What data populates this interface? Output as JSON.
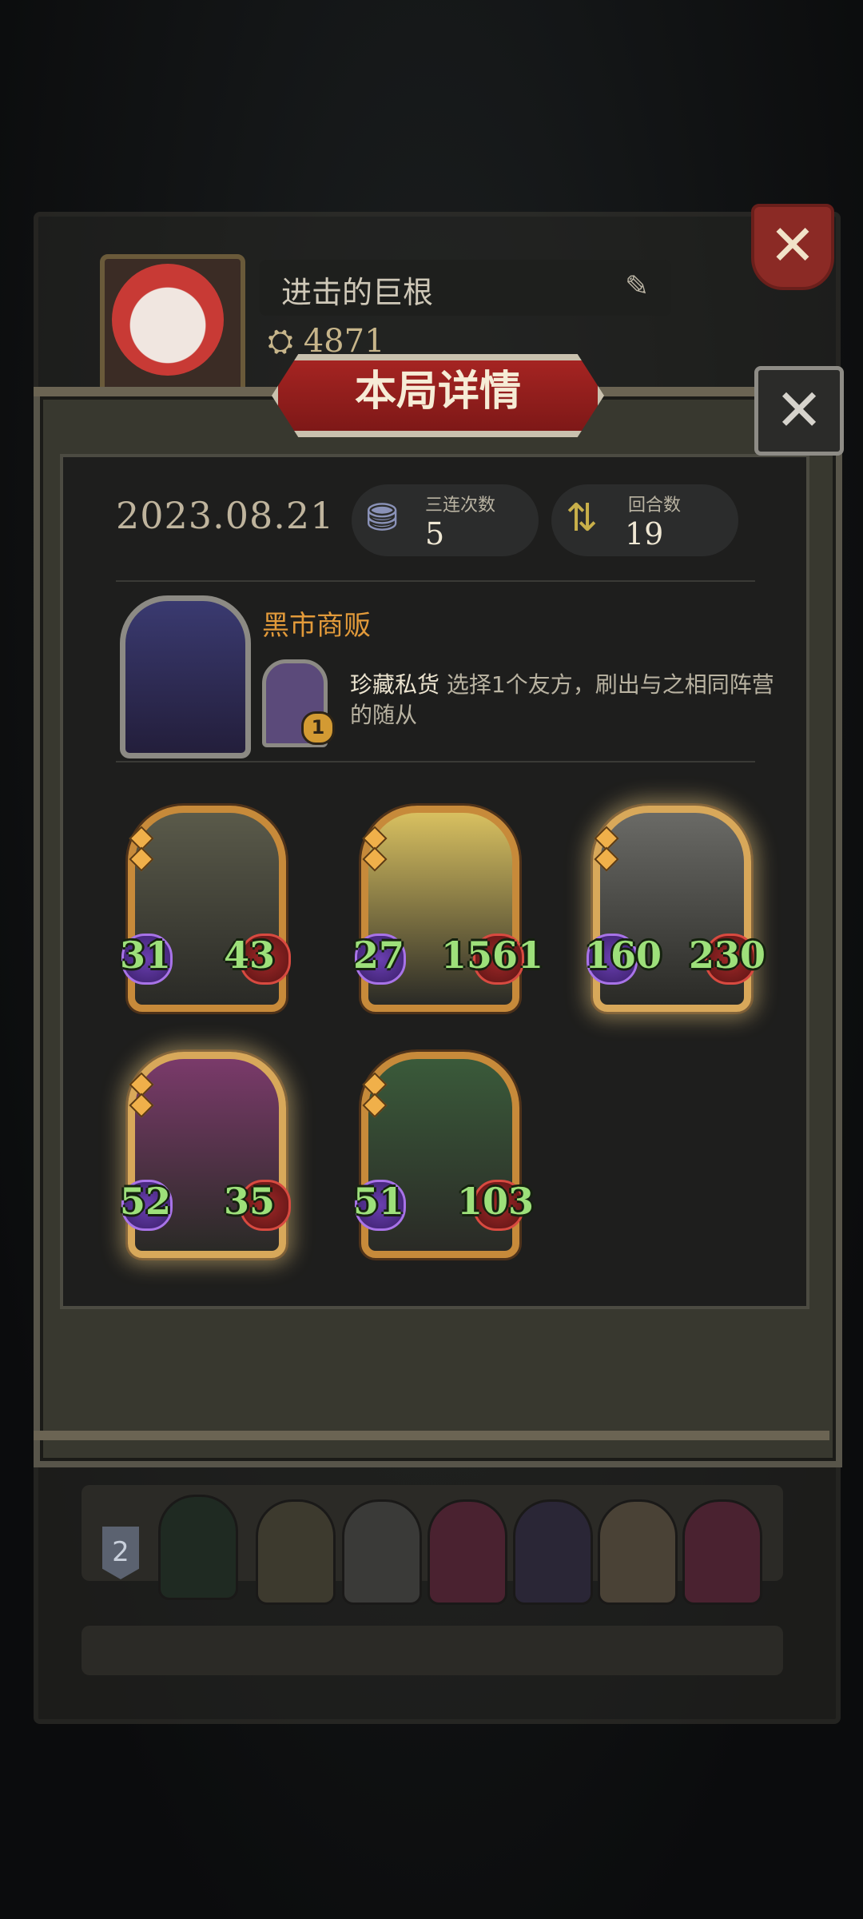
{
  "back_panel": {
    "player_name": "进击的巨根",
    "coins": "4871"
  },
  "modal": {
    "title": "本局详情",
    "date": "2023.08.21",
    "stats": [
      {
        "label": "三连次数",
        "value": "5",
        "icon": "triple-stack-icon"
      },
      {
        "label": "回合数",
        "value": "19",
        "icon": "turn-cycle-icon"
      }
    ],
    "hero": {
      "name": "黑市商贩",
      "ability_name": "珍藏私货",
      "ability_desc": "选择1个友方，刷出与之相同阵营的随从",
      "ability_cost": "1"
    },
    "units": [
      {
        "atk": "31",
        "hp": "43",
        "golden": false,
        "art": "#5a5a4a"
      },
      {
        "atk": "27",
        "hp": "1561",
        "golden": false,
        "art": "#d8c060"
      },
      {
        "atk": "160",
        "hp": "230",
        "golden": true,
        "art": "#6a6a66"
      },
      {
        "atk": "52",
        "hp": "35",
        "golden": true,
        "art": "#7a3a6a"
      },
      {
        "atk": "51",
        "hp": "103",
        "golden": false,
        "art": "#3a5a3a"
      }
    ]
  },
  "bottom_rows": [
    {
      "rank": "2"
    }
  ],
  "colors": {
    "accent_red": "#a52422",
    "stat_green": "#9de07a",
    "merchant_orange": "#e29a3a"
  }
}
